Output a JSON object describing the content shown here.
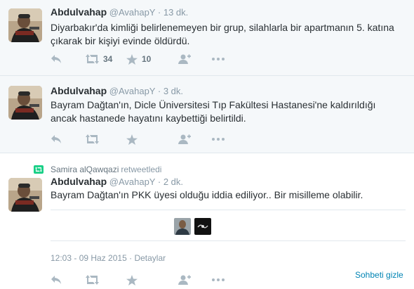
{
  "tweets": [
    {
      "fullname": "Abdulvahap",
      "username": "@AvahapY",
      "separator": "·",
      "time": "13 dk.",
      "text_line1": "Diyarbakır'da kimliği belirlenemeyen bir grup, silahlarla bir apartmanın 5. katına",
      "text_line2": "çıkarak bir kişiyi evinde öldürdü.",
      "retweets": "34",
      "favorites": "10"
    },
    {
      "fullname": "Abdulvahap",
      "username": "@AvahapY",
      "separator": "·",
      "time": "3 dk.",
      "text_line1": "Bayram Dağtan'ın, Dicle Üniversitesi Tıp Fakültesi Hastanesi'ne kaldırıldığı",
      "text_line2": "ancak hastanede hayatını kaybettiği belirtildi."
    },
    {
      "retweeter": "Samira alQawqazi",
      "retweet_suffix": "retweetledi",
      "fullname": "Abdulvahap",
      "username": "@AvahapY",
      "separator": "·",
      "time": "2 dk.",
      "text_line1": "Bayram Dağtan'ın PKK üyesi olduğu iddia ediliyor.. Bir misilleme olabilir.",
      "timestamp": "12:03 - 09 Haz 2015",
      "details": "Detaylar"
    }
  ],
  "conversation": {
    "hide_label": "Sohbeti gizle"
  },
  "icons": [
    "reply-icon",
    "retweet-icon",
    "favorite-icon",
    "follow-icon",
    "more-icon"
  ],
  "colors": {
    "link": "#0084b4",
    "muted": "#8899a6",
    "retweet_green": "#19cf86",
    "conversation_bg": "#f5f8fa"
  }
}
